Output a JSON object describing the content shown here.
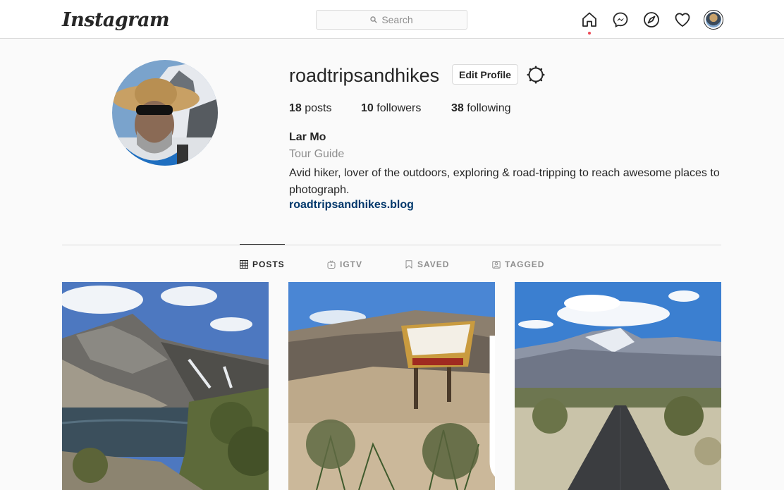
{
  "nav": {
    "logo": "Instagram",
    "search_placeholder": "Search",
    "icons": [
      "home-icon",
      "messenger-icon",
      "explore-icon",
      "heart-icon",
      "avatar"
    ],
    "notification_dot_color": "#ed4956"
  },
  "profile": {
    "username": "roadtripsandhikes",
    "edit_button": "Edit Profile",
    "stats": {
      "posts_count": "18",
      "posts_label": " posts",
      "followers_count": "10",
      "followers_label": " followers",
      "following_count": "38",
      "following_label": " following"
    },
    "full_name": "Lar Mo",
    "category": "Tour Guide",
    "bio": "Avid hiker, lover of the outdoors, exploring & road-tripping to reach awesome places to photograph.",
    "website": "roadtripsandhikes.blog"
  },
  "tabs": [
    {
      "label": "POSTS",
      "icon": "grid-icon",
      "active": true
    },
    {
      "label": "IGTV",
      "icon": "igtv-icon",
      "active": false
    },
    {
      "label": "SAVED",
      "icon": "bookmark-icon",
      "active": false
    },
    {
      "label": "TAGGED",
      "icon": "tagged-icon",
      "active": false
    }
  ],
  "colors": {
    "link": "#00376b",
    "text": "#262626",
    "secondary": "#8e8e8e",
    "border": "#dbdbdb"
  }
}
